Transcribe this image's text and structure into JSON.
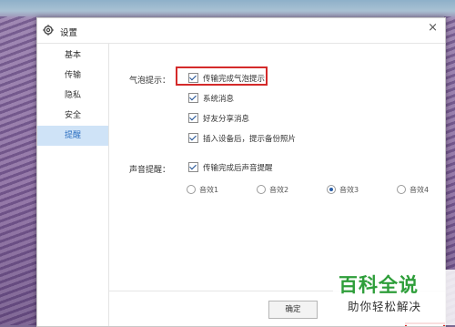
{
  "window": {
    "title": "设置",
    "icon": "gear-icon",
    "close_glyph": "×"
  },
  "sidebar": {
    "items": [
      {
        "label": "基本",
        "active": false
      },
      {
        "label": "传输",
        "active": false
      },
      {
        "label": "隐私",
        "active": false
      },
      {
        "label": "安全",
        "active": false
      },
      {
        "label": "提醒",
        "active": true
      }
    ]
  },
  "bubble": {
    "label": "气泡提示：",
    "options": [
      {
        "label": "传输完成气泡提示",
        "checked": true
      },
      {
        "label": "系统消息",
        "checked": true
      },
      {
        "label": "好友分享消息",
        "checked": true
      },
      {
        "label": "插入设备后，提示备份照片",
        "checked": true
      }
    ]
  },
  "sound": {
    "label": "声音提醒：",
    "checkbox": {
      "label": "传输完成后声音提醒",
      "checked": true
    },
    "effects": [
      {
        "label": "音效1",
        "selected": false
      },
      {
        "label": "音效2",
        "selected": false
      },
      {
        "label": "音效3",
        "selected": true
      },
      {
        "label": "音效4",
        "selected": false
      }
    ]
  },
  "footer": {
    "ok_label": "确定"
  },
  "watermark": {
    "main": "百科全说",
    "sub": "助你轻松解决"
  },
  "colors": {
    "accent": "#2c6fc0",
    "highlight": "#d42a2a",
    "active_bg": "#cfe3f7",
    "watermark_green": "#2e9e3a"
  }
}
